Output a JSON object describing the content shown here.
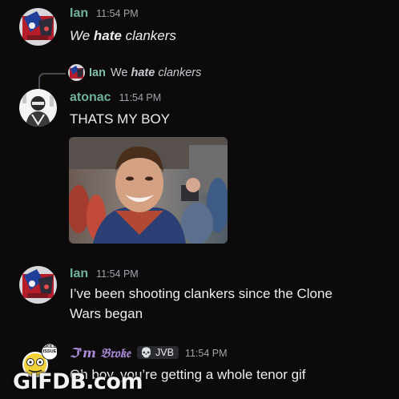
{
  "messages": [
    {
      "username": "Ian",
      "time": "11:54 PM",
      "text_plain": "We ",
      "text_emph": "hate",
      "text_rest": " clankers"
    },
    {
      "reply_to": {
        "username": "Ian",
        "text_plain": "We ",
        "text_emph": "hate",
        "text_rest": " clankers"
      },
      "username": "atonac",
      "time": "11:54 PM",
      "text": "THATS MY BOY",
      "attachment": "gif-image"
    },
    {
      "username": "Ian",
      "time": "11:54 PM",
      "text_line1": "I’ve been shooting clankers since the Clone",
      "text_line2": "Wars began"
    },
    {
      "username": "ℑ'm 𝔅𝔯𝔬𝔨𝔢",
      "tag": "JVB",
      "tag_icon": "skull-icon",
      "avatar_badge": "SKILL ISSUE",
      "time": "11:54 PM",
      "text": "Oh boy, you’re getting a whole tenor gif"
    }
  ],
  "watermark": "GIFDB.com",
  "colors": {
    "background": "#0d0a0c",
    "username": "#6fb39a",
    "broke_username": "#a98bd8",
    "timestamp": "#a3a3ad",
    "text": "#ececf0"
  }
}
